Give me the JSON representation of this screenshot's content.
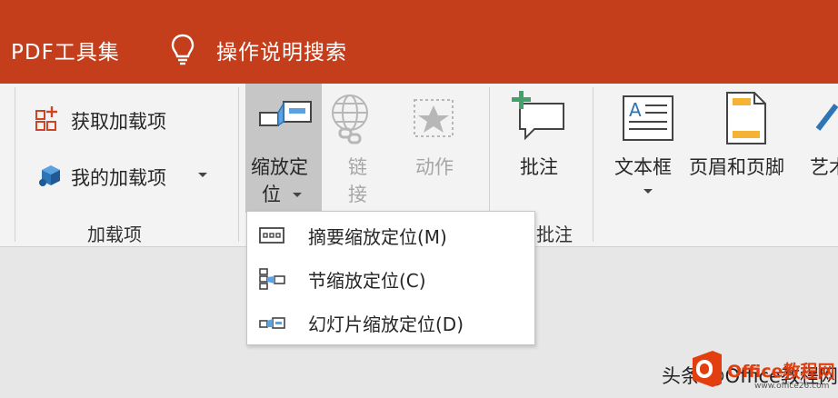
{
  "title_tabs": [
    "PDF工具集",
    "操作说明搜索"
  ],
  "ribbon": {
    "get_addins": "获取加载项",
    "my_addins": "我的加载项",
    "addins_group": "加载项",
    "zoom_line1": "缩放定",
    "zoom_line2": "位",
    "link_line1": "链",
    "link_line2": "接",
    "action": "动作",
    "comment": "批注",
    "comment_group_partial": "批注",
    "textbox": "文本框",
    "header_footer": "页眉和页脚",
    "wordart_partial": "艺术"
  },
  "zoom_menu": [
    {
      "label": "摘要缩放定位(M)",
      "icon": "summary-zoom-icon"
    },
    {
      "label": "节缩放定位(C)",
      "icon": "section-zoom-icon"
    },
    {
      "label": "幻灯片缩放定位(D)",
      "icon": "slide-zoom-icon"
    }
  ],
  "watermark": {
    "text": "头条 @Office教程网",
    "brand": "Office教程网",
    "url": "www.office26.com"
  },
  "colors": {
    "title_bar": "#c43e1c",
    "accent_red": "#d04423",
    "accent_blue": "#2e75b6",
    "accent_green": "#41a36b",
    "accent_yellow": "#f5b335"
  }
}
